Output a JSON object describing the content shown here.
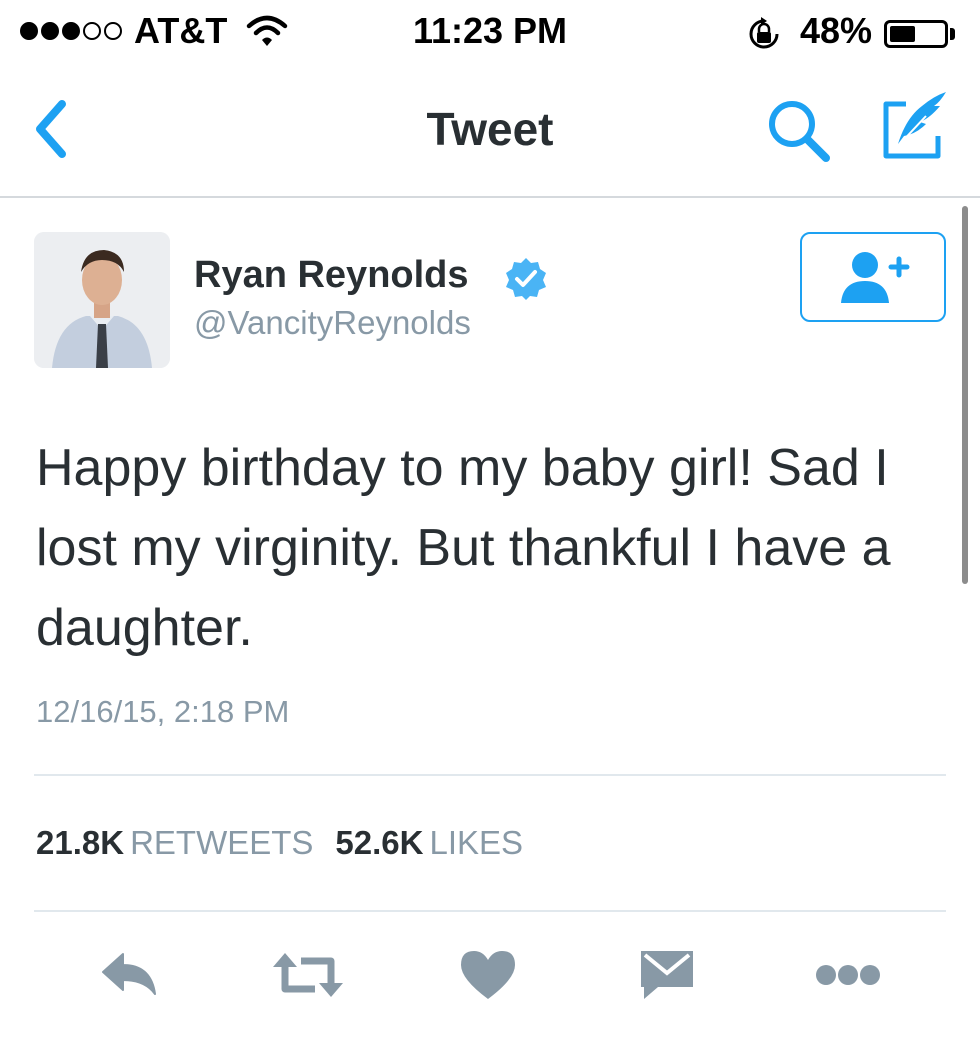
{
  "status_bar": {
    "carrier": "AT&T",
    "time": "11:23 PM",
    "battery_percent": "48%",
    "battery_level": 0.48,
    "signal_bars": 3,
    "signal_total": 5
  },
  "nav": {
    "title": "Tweet",
    "accent_color": "#1da1f2"
  },
  "tweet": {
    "author_name": "Ryan Reynolds",
    "handle": "@VancityReynolds",
    "verified": true,
    "text": "Happy birthday to my baby girl! Sad I lost my virginity. But thankful I have a daughter.",
    "timestamp": "12/16/15, 2:18 PM",
    "retweets": "21.8K",
    "retweets_label": "RETWEETS",
    "likes": "52.6K",
    "likes_label": "LIKES"
  },
  "icons": {
    "back": "chevron-left-icon",
    "search": "search-icon",
    "compose": "compose-icon",
    "follow": "add-user-icon",
    "reply": "reply-icon",
    "retweet": "retweet-icon",
    "like": "heart-icon",
    "message": "envelope-icon",
    "more": "more-icon"
  }
}
